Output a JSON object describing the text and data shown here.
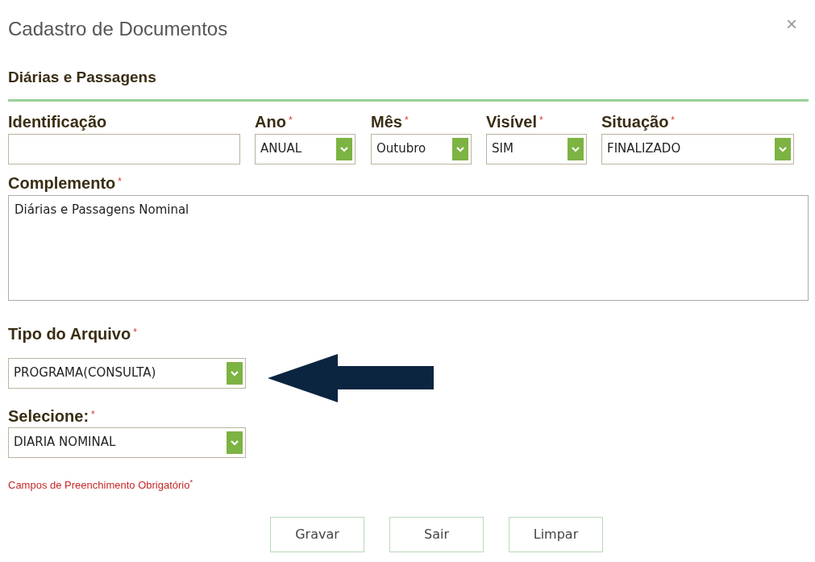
{
  "dialog": {
    "title": "Cadastro de Documentos",
    "close": "×"
  },
  "section": {
    "title": "Diárias e Passagens"
  },
  "top_fields": [
    {
      "kind": "text",
      "label": "Identificação"
    },
    {
      "kind": "select",
      "label": "Ano",
      "mark": "*",
      "value": "ANUAL"
    },
    {
      "kind": "select",
      "label": "Mês",
      "mark": "*",
      "value": "Outubro"
    },
    {
      "kind": "select",
      "label": "Visível",
      "mark": "*",
      "value": "SIM"
    },
    {
      "kind": "select",
      "label": "Situação",
      "mark": "*",
      "value": "FINALIZADO"
    }
  ],
  "complemento": {
    "label": "Complemento",
    "mark": "*",
    "value": "Diárias e Passagens Nominal"
  },
  "tipo_arquivo": {
    "label": "Tipo do Arquivo",
    "mark": "*",
    "value": "PROGRAMA(CONSULTA)"
  },
  "selecione": {
    "label": "Selecione:",
    "mark": "*",
    "value": "DIARIA NOMINAL"
  },
  "required_note": "Campos de Preenchimento Obrigatório$^{*}$",
  "buttons": [
    "Gravar",
    "Sair",
    "Limpar"
  ]
}
